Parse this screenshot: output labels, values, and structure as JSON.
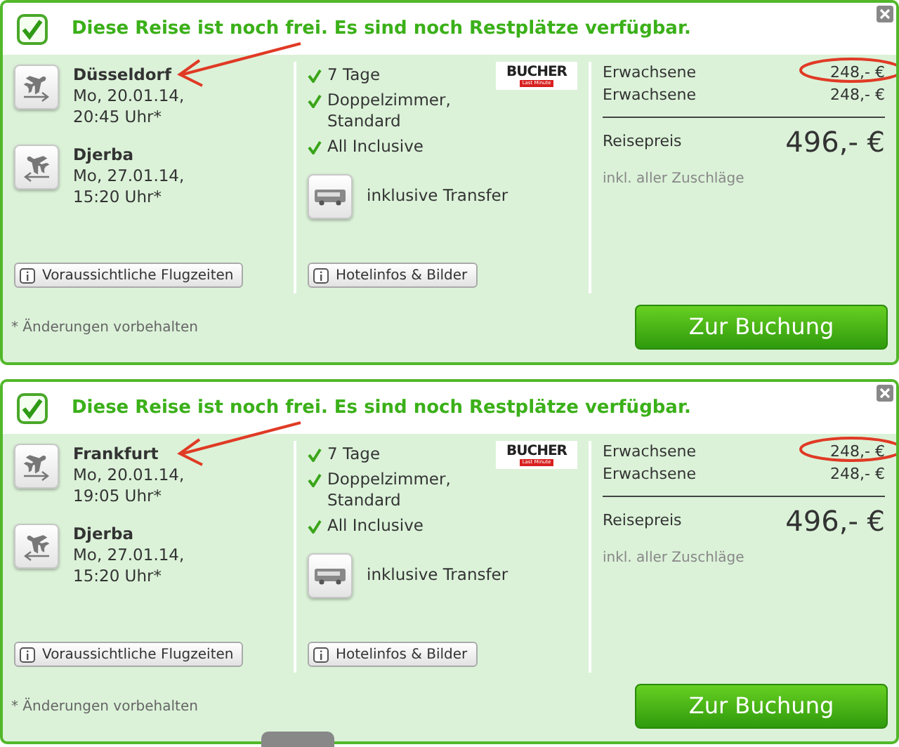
{
  "trips": [
    {
      "status": "Diese Reise ist noch frei. Es sind noch Restplätze verfügbar.",
      "flights": [
        {
          "kind": "outbound",
          "city": "Düsseldorf",
          "date": "Mo, 20.01.14,",
          "time": "20:45 Uhr*"
        },
        {
          "kind": "return",
          "city": "Djerba",
          "date": "Mo, 27.01.14,",
          "time": "15:20 Uhr*"
        }
      ],
      "flight_times_button": "Voraussichtliche Flugzeiten",
      "features": [
        "7 Tage",
        "Doppelzimmer, Standard",
        "All Inclusive"
      ],
      "logo": {
        "name": "BUCHER",
        "tagline": "Last Minute"
      },
      "transfer": "inklusive Transfer",
      "hotel_button": "Hotelinfos & Bilder",
      "travellers": [
        {
          "label": "Erwachsene",
          "price": "248,- €"
        },
        {
          "label": "Erwachsene",
          "price": "248,- €"
        }
      ],
      "total_label": "Reisepreis",
      "total": "496,- €",
      "total_note": "inkl. aller Zuschläge",
      "footnote": "* Änderungen vorbehalten",
      "book_button": "Zur Buchung"
    },
    {
      "status": "Diese Reise ist noch frei. Es sind noch Restplätze verfügbar.",
      "flights": [
        {
          "kind": "outbound",
          "city": "Frankfurt",
          "date": "Mo, 20.01.14,",
          "time": "19:05 Uhr*"
        },
        {
          "kind": "return",
          "city": "Djerba",
          "date": "Mo, 27.01.14,",
          "time": "15:20 Uhr*"
        }
      ],
      "flight_times_button": "Voraussichtliche Flugzeiten",
      "features": [
        "7 Tage",
        "Doppelzimmer, Standard",
        "All Inclusive"
      ],
      "logo": {
        "name": "BUCHER",
        "tagline": "Last Minute"
      },
      "transfer": "inklusive Transfer",
      "hotel_button": "Hotelinfos & Bilder",
      "travellers": [
        {
          "label": "Erwachsene",
          "price": "248,- €"
        },
        {
          "label": "Erwachsene",
          "price": "248,- €"
        }
      ],
      "total_label": "Reisepreis",
      "total": "496,- €",
      "total_note": "inkl. aller Zuschläge",
      "footnote": "* Änderungen vorbehalten",
      "book_button": "Zur Buchung"
    }
  ]
}
